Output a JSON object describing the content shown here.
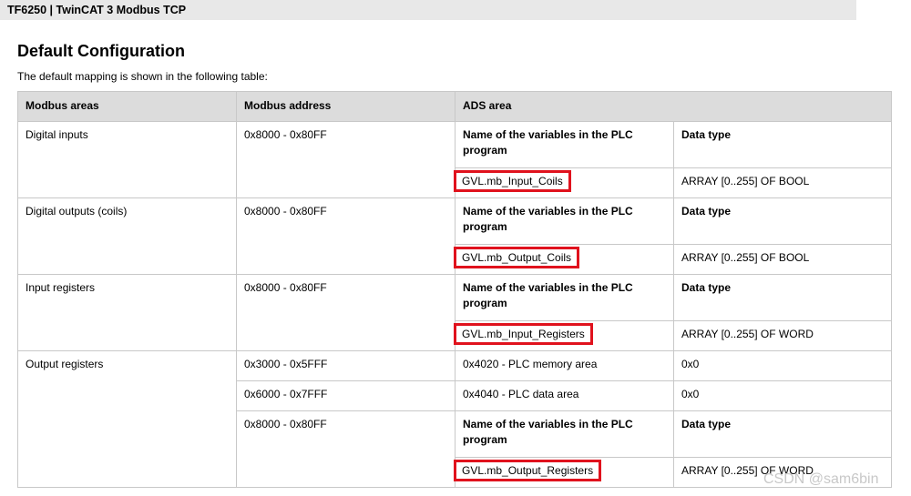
{
  "header": {
    "title": "TF6250 | TwinCAT 3 Modbus TCP"
  },
  "section": {
    "title": "Default Configuration",
    "intro": "The default mapping is shown in the following table:"
  },
  "table": {
    "headers": [
      "Modbus areas",
      "Modbus address",
      "ADS area"
    ],
    "name_header": "Name of the variables in the PLC program",
    "type_header": "Data type",
    "rows": [
      {
        "area": "Digital inputs",
        "address": "0x8000 - 0x80FF",
        "variable": "GVL.mb_Input_Coils",
        "type": "ARRAY [0..255] OF BOOL"
      },
      {
        "area": "Digital outputs (coils)",
        "address": "0x8000 - 0x80FF",
        "variable": "GVL.mb_Output_Coils",
        "type": "ARRAY [0..255] OF BOOL"
      },
      {
        "area": "Input registers",
        "address": "0x8000 - 0x80FF",
        "variable": "GVL.mb_Input_Registers",
        "type": "ARRAY [0..255] OF WORD"
      },
      {
        "area": "Output registers",
        "sub": [
          {
            "address": "0x3000 - 0x5FFF",
            "ads": "0x4020 - PLC memory area",
            "value": "0x0"
          },
          {
            "address": "0x6000 - 0x7FFF",
            "ads": "0x4040 - PLC data area",
            "value": "0x0"
          }
        ],
        "address": "0x8000 - 0x80FF",
        "variable": "GVL.mb_Output_Registers",
        "type": "ARRAY [0..255] OF WORD"
      }
    ]
  },
  "watermark": "CSDN @sam6bin",
  "colors": {
    "highlight": "#e0121d",
    "header_bg": "#dcdcdc"
  }
}
